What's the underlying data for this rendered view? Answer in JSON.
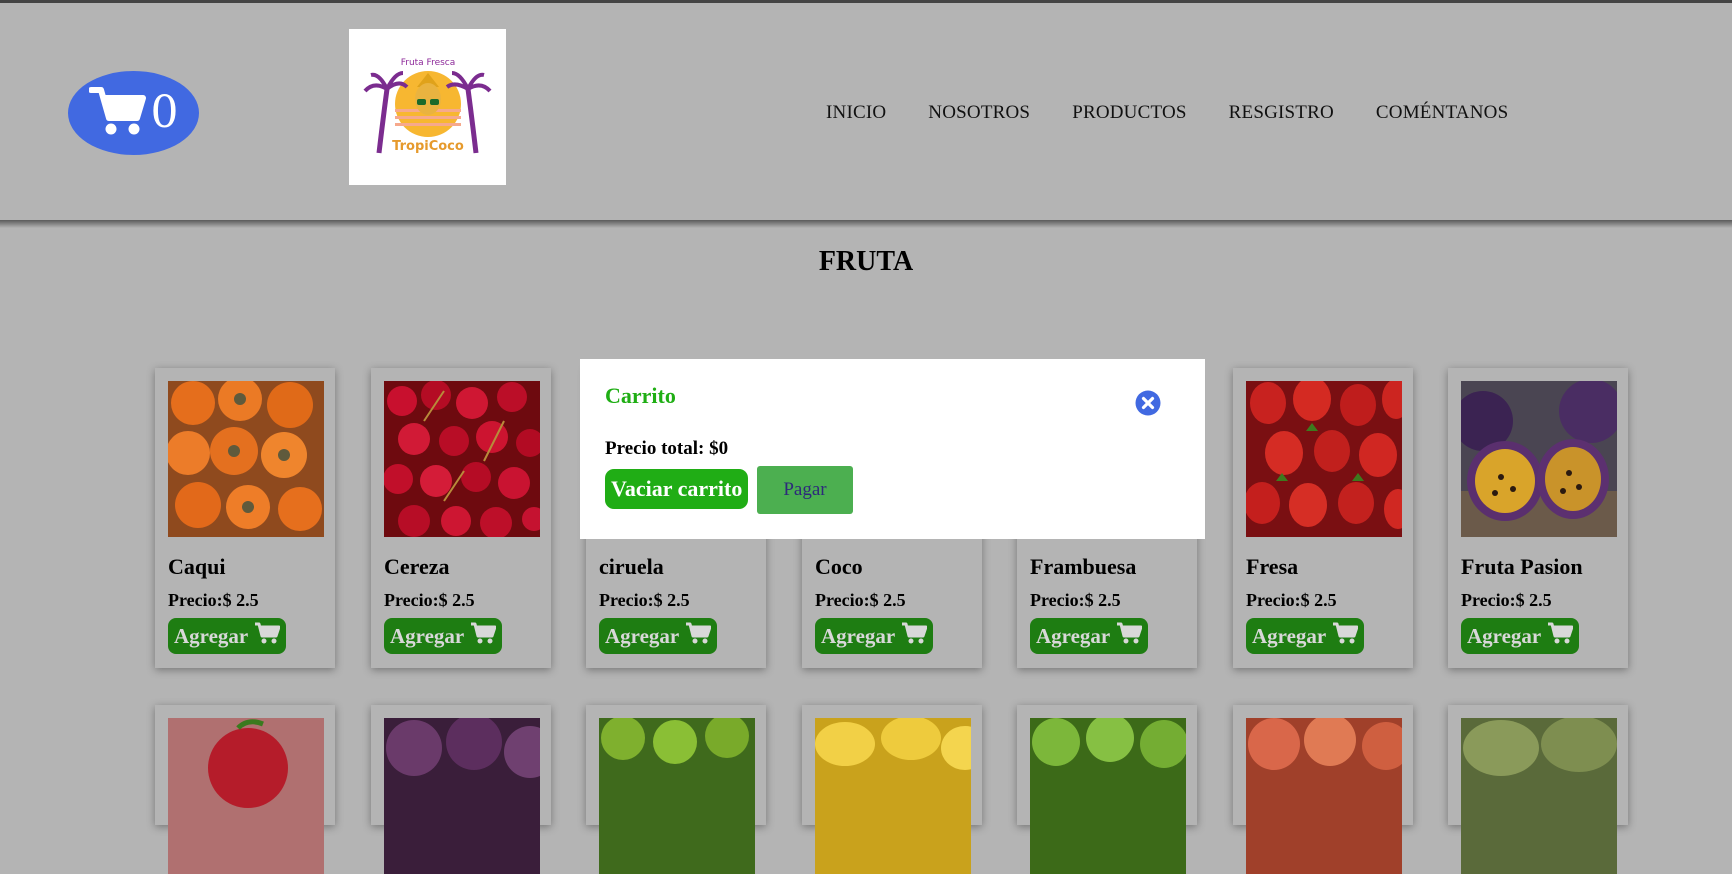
{
  "header": {
    "cart_count": "0",
    "logo_top_text": "Fruta Fresca",
    "logo_bottom_text": "TropiCoco",
    "nav": [
      "INICIO",
      "NOSOTROS",
      "PRODUCTOS",
      "RESGISTRO",
      "COMÉNTANOS"
    ]
  },
  "section": {
    "title": "FRUTA"
  },
  "products": [
    {
      "name": "Caqui",
      "price_label": "Precio:",
      "price": "$ 2.5",
      "button": "Agregar"
    },
    {
      "name": "Cereza",
      "price_label": "Precio:",
      "price": "$ 2.5",
      "button": "Agregar"
    },
    {
      "name": "ciruela",
      "price_label": "Precio:",
      "price": "$ 2.5",
      "button": "Agregar"
    },
    {
      "name": "Coco",
      "price_label": "Precio:",
      "price": "$ 2.5",
      "button": "Agregar"
    },
    {
      "name": "Frambuesa",
      "price_label": "Precio:",
      "price": "$ 2.5",
      "button": "Agregar"
    },
    {
      "name": "Fresa",
      "price_label": "Precio:",
      "price": "$ 2.5",
      "button": "Agregar"
    },
    {
      "name": "Fruta Pasion",
      "price_label": "Precio:",
      "price": "$ 2.5",
      "button": "Agregar"
    }
  ],
  "modal": {
    "title": "Carrito",
    "total_label": "Precio total: $0",
    "empty_button": "Vaciar carrito",
    "pay_button": "Pagar"
  },
  "colors": {
    "cart_pill": "#4169e1",
    "modal_title": "#1fae14",
    "add_button": "#1e7d12",
    "pay_button": "#4caf50"
  }
}
